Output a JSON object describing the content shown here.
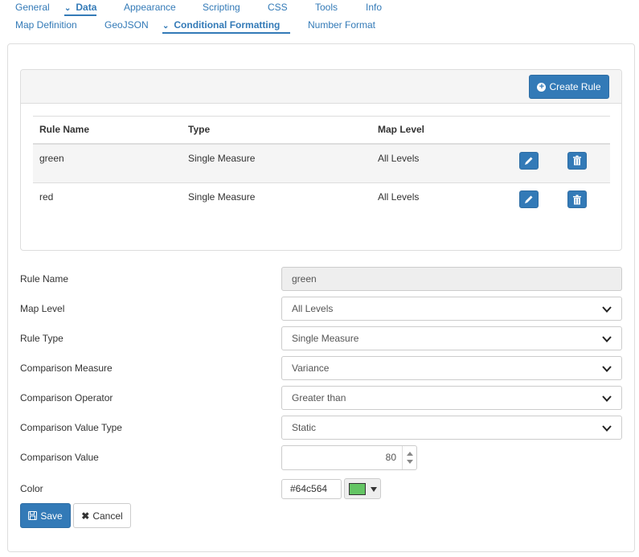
{
  "top_tabs": [
    {
      "label": "General",
      "active": false
    },
    {
      "label": "Data",
      "active": true
    },
    {
      "label": "Appearance",
      "active": false
    },
    {
      "label": "Scripting",
      "active": false
    },
    {
      "label": "CSS",
      "active": false
    },
    {
      "label": "Tools",
      "active": false
    },
    {
      "label": "Info",
      "active": false
    }
  ],
  "sub_tabs": [
    {
      "label": "Map Definition",
      "active": false
    },
    {
      "label": "GeoJSON",
      "active": false
    },
    {
      "label": "Conditional Formatting",
      "active": true
    },
    {
      "label": "Number Format",
      "active": false
    }
  ],
  "rules_panel": {
    "create_button_label": "Create Rule",
    "columns": [
      "Rule Name",
      "Type",
      "Map Level"
    ],
    "rows": [
      {
        "name": "green",
        "type": "Single Measure",
        "level": "All Levels"
      },
      {
        "name": "red",
        "type": "Single Measure",
        "level": "All Levels"
      }
    ]
  },
  "form": {
    "rule_name": {
      "label": "Rule Name",
      "value": "green"
    },
    "map_level": {
      "label": "Map Level",
      "value": "All Levels"
    },
    "rule_type": {
      "label": "Rule Type",
      "value": "Single Measure"
    },
    "comparison_measure": {
      "label": "Comparison Measure",
      "value": "Variance"
    },
    "comparison_operator": {
      "label": "Comparison Operator",
      "value": "Greater than"
    },
    "comparison_value_type": {
      "label": "Comparison Value Type",
      "value": "Static"
    },
    "comparison_value": {
      "label": "Comparison Value",
      "value": "80"
    },
    "color": {
      "label": "Color",
      "value": "#64c564"
    }
  },
  "actions": {
    "save_label": "Save",
    "cancel_label": "Cancel"
  },
  "colors": {
    "accent": "#337ab7",
    "swatch": "#64c564"
  }
}
